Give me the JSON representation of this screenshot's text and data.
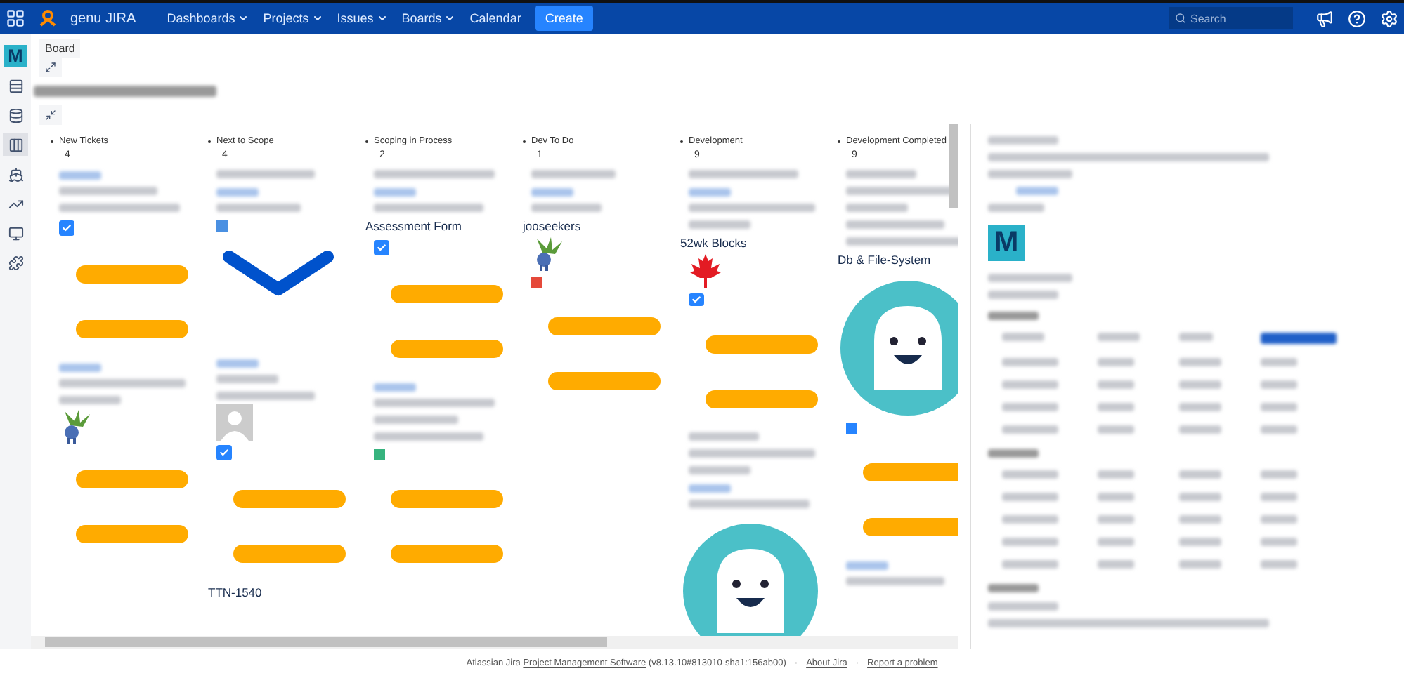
{
  "topbar": {
    "product": "genu JIRA",
    "menus": [
      {
        "label": "Dashboards",
        "dropdown": true
      },
      {
        "label": "Projects",
        "dropdown": true
      },
      {
        "label": "Issues",
        "dropdown": true
      },
      {
        "label": "Boards",
        "dropdown": true
      },
      {
        "label": "Calendar",
        "dropdown": false
      }
    ],
    "create": "Create",
    "search": {
      "placeholder": "Search"
    }
  },
  "sidebar": {
    "project_avatar": "M",
    "items": [
      {
        "kind": "backlog",
        "selected": false
      },
      {
        "kind": "stack",
        "selected": false
      },
      {
        "kind": "board",
        "selected": true
      },
      {
        "kind": "releases",
        "selected": false
      },
      {
        "kind": "reports",
        "selected": false
      },
      {
        "kind": "display",
        "selected": false
      },
      {
        "kind": "addons",
        "selected": false
      }
    ]
  },
  "board": {
    "breadcrumb": "Board",
    "columns": [
      {
        "title": "New Tickets",
        "count": "4",
        "cards": [
          {
            "kind": "link"
          },
          {
            "kind": "line"
          },
          {
            "kind": "line"
          },
          {
            "kind": "checkbox",
            "checked": true
          },
          {
            "kind": "pills"
          },
          {
            "kind": "link"
          },
          {
            "kind": "line"
          },
          {
            "kind": "line"
          },
          {
            "kind": "plant"
          },
          {
            "kind": "pills"
          }
        ]
      },
      {
        "title": "Next to Scope",
        "count": "4",
        "cards": [
          {
            "kind": "line"
          },
          {
            "kind": "link"
          },
          {
            "kind": "line"
          },
          {
            "kind": "tag",
            "color": "#4a90e2"
          },
          {
            "kind": "chevron"
          },
          {
            "kind": "link"
          },
          {
            "kind": "line"
          },
          {
            "kind": "line"
          },
          {
            "kind": "avatar"
          },
          {
            "kind": "checkbox",
            "checked": true
          },
          {
            "kind": "pills"
          },
          {
            "kind": "text",
            "text": "TTN-1540"
          }
        ]
      },
      {
        "title": "Scoping in Process",
        "count": "2",
        "cards": [
          {
            "kind": "line"
          },
          {
            "kind": "link"
          },
          {
            "kind": "line"
          },
          {
            "kind": "text",
            "text": "Assessment Form"
          },
          {
            "kind": "checkbox",
            "checked": true
          },
          {
            "kind": "pills"
          },
          {
            "kind": "link"
          },
          {
            "kind": "line"
          },
          {
            "kind": "line"
          },
          {
            "kind": "line"
          },
          {
            "kind": "tag",
            "color": "#36b37e"
          },
          {
            "kind": "pills"
          }
        ]
      },
      {
        "title": "Dev To Do",
        "count": "1",
        "cards": [
          {
            "kind": "line"
          },
          {
            "kind": "link"
          },
          {
            "kind": "line"
          },
          {
            "kind": "text",
            "text": "jooseekers"
          },
          {
            "kind": "plant"
          },
          {
            "kind": "tag",
            "color": "#e5493a"
          },
          {
            "kind": "pills"
          }
        ]
      },
      {
        "title": "Development",
        "count": "9",
        "cards": [
          {
            "kind": "line"
          },
          {
            "kind": "link"
          },
          {
            "kind": "line"
          },
          {
            "kind": "line"
          },
          {
            "kind": "text",
            "text": "52wk Blocks"
          },
          {
            "kind": "flag"
          },
          {
            "kind": "checkbox",
            "checked": true
          },
          {
            "kind": "pills"
          },
          {
            "kind": "line"
          },
          {
            "kind": "line"
          },
          {
            "kind": "line"
          },
          {
            "kind": "link"
          },
          {
            "kind": "line"
          },
          {
            "kind": "ghost"
          }
        ]
      },
      {
        "title": "Development Completed",
        "count": "9",
        "cards": [
          {
            "kind": "line"
          },
          {
            "kind": "line"
          },
          {
            "kind": "line"
          },
          {
            "kind": "line"
          },
          {
            "kind": "line"
          },
          {
            "kind": "text",
            "text": "Db & File-System"
          },
          {
            "kind": "ghost"
          },
          {
            "kind": "tag",
            "color": "#2684ff"
          },
          {
            "kind": "pills"
          },
          {
            "kind": "link"
          },
          {
            "kind": "line"
          }
        ]
      }
    ]
  },
  "detail": {
    "project_avatar": "M",
    "items": [
      {
        "kind": "line"
      },
      {
        "kind": "line"
      },
      {
        "kind": "line"
      },
      {
        "kind": "link"
      },
      {
        "kind": "line"
      },
      {
        "kind": "avatar"
      },
      {
        "kind": "line"
      },
      {
        "kind": "line"
      },
      {
        "kind": "heading"
      },
      {
        "kind": "action-row"
      },
      {
        "kind": "row"
      },
      {
        "kind": "row"
      },
      {
        "kind": "row"
      },
      {
        "kind": "row"
      },
      {
        "kind": "heading"
      },
      {
        "kind": "row"
      },
      {
        "kind": "row"
      },
      {
        "kind": "row"
      },
      {
        "kind": "row"
      },
      {
        "kind": "row"
      },
      {
        "kind": "heading"
      },
      {
        "kind": "line"
      },
      {
        "kind": "line"
      }
    ]
  },
  "footer": {
    "prefix": "Atlassian Jira",
    "link": "Project Management Software",
    "version": "(v8.13.10#813010-sha1:156ab00)",
    "separator": "·",
    "links": [
      "About Jira",
      "Report a problem"
    ]
  }
}
